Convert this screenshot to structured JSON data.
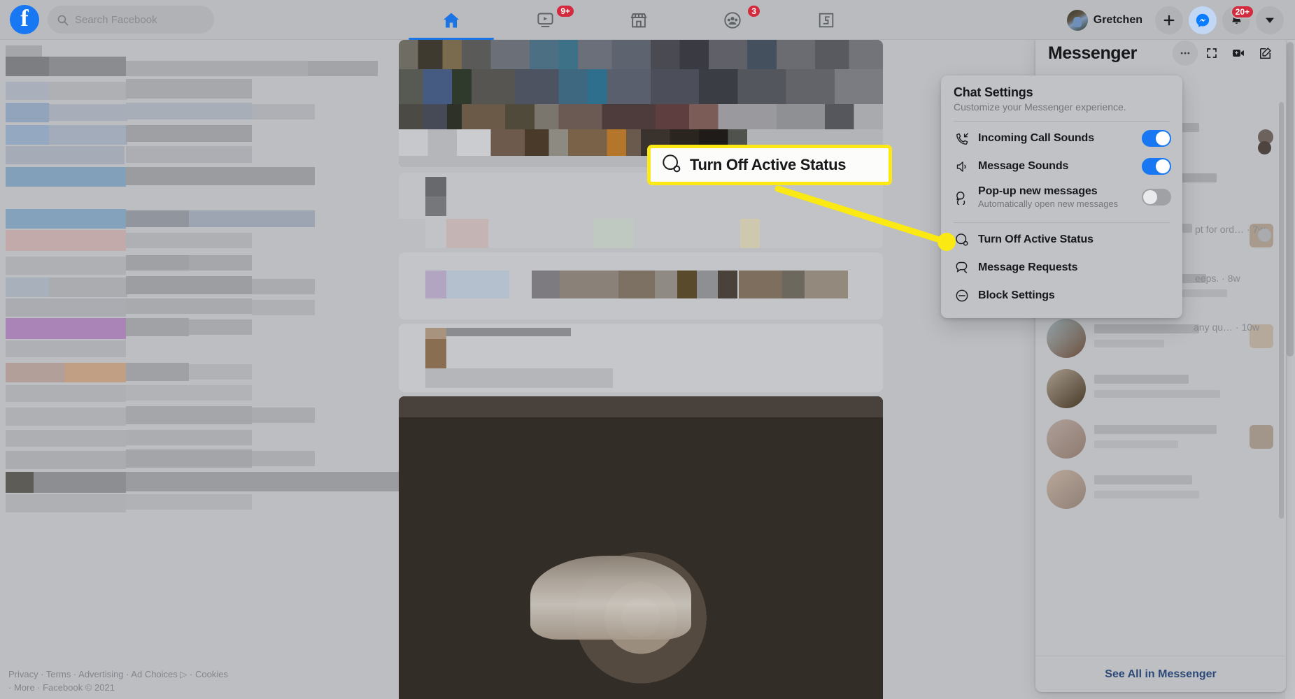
{
  "topbar": {
    "logo_icon": "facebook-logo-icon",
    "search": {
      "placeholder": "Search Facebook",
      "icon": "search-icon"
    },
    "tabs": [
      {
        "name": "home",
        "icon": "home-icon",
        "badge": "",
        "active": true
      },
      {
        "name": "watch",
        "icon": "video-play-icon",
        "badge": "9+",
        "active": false
      },
      {
        "name": "marketplace",
        "icon": "storefront-icon",
        "badge": "",
        "active": false
      },
      {
        "name": "groups",
        "icon": "groups-icon",
        "badge": "3",
        "active": false
      },
      {
        "name": "gaming",
        "icon": "gaming-icon",
        "badge": "",
        "active": false
      }
    ],
    "profile_name": "Gretchen",
    "actions": [
      {
        "name": "create",
        "icon": "plus-icon",
        "badge": ""
      },
      {
        "name": "messenger",
        "icon": "messenger-icon",
        "badge": ""
      },
      {
        "name": "notifications",
        "icon": "bell-icon",
        "badge": "20+"
      },
      {
        "name": "account-menu",
        "icon": "chevron-down-icon",
        "badge": ""
      }
    ]
  },
  "messenger_panel": {
    "title": "Messenger",
    "actions": [
      {
        "name": "options",
        "icon": "ellipsis-icon"
      },
      {
        "name": "expand",
        "icon": "expand-icon"
      },
      {
        "name": "video-chat",
        "icon": "video-plus-icon"
      },
      {
        "name": "new-message",
        "icon": "compose-icon"
      }
    ],
    "conversations": [
      {
        "snippet": "pt for ord… · 7w",
        "badge": "unread-dot"
      },
      {
        "snippet": "eeps. · 8w",
        "badge": "seen-check"
      },
      {
        "snippet": "any qu…  · 10w",
        "badge": ""
      }
    ],
    "see_all_label": "See All in Messenger"
  },
  "chat_settings": {
    "title": "Chat Settings",
    "subtitle": "Customize your Messenger experience.",
    "toggles": [
      {
        "label": "Incoming Call Sounds",
        "desc": "",
        "icon": "incoming-call-icon",
        "state": "on"
      },
      {
        "label": "Message Sounds",
        "desc": "",
        "icon": "speaker-icon",
        "state": "on"
      },
      {
        "label": "Pop-up new messages",
        "desc": "Automatically open new messages",
        "icon": "popup-bubbles-icon",
        "state": "off"
      }
    ],
    "items": [
      {
        "label": "Turn Off Active Status",
        "icon": "active-status-icon",
        "highlighted": true
      },
      {
        "label": "Message Requests",
        "icon": "message-requests-icon",
        "highlighted": false
      },
      {
        "label": "Block Settings",
        "icon": "block-icon",
        "highlighted": false
      }
    ]
  },
  "callout": {
    "label": "Turn Off Active Status",
    "icon": "active-status-icon",
    "highlight_color": "#FAE913"
  },
  "footer": {
    "line1": "Privacy · Terms · Advertising · Ad Choices ▷ · Cookies",
    "line2": "· More · Facebook © 2021"
  },
  "colors": {
    "facebook_blue": "#1877F2",
    "badge_red": "#D32A3D",
    "highlight_yellow": "#FAE913",
    "page_bg": "#BCBEC2",
    "link_blue": "#2C4876"
  }
}
